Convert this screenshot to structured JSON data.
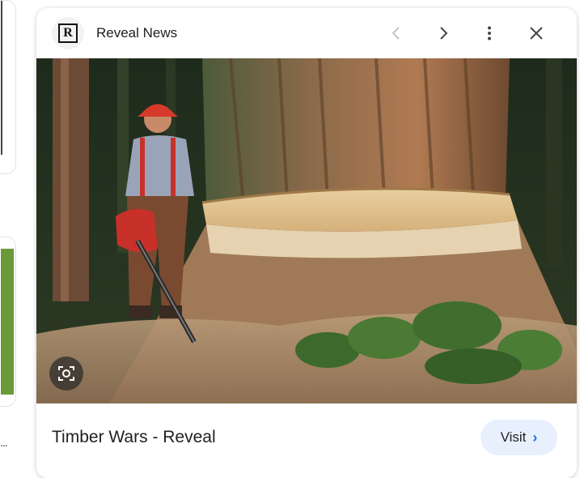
{
  "header": {
    "source_logo_letter": "R",
    "source_name": "Reveal News",
    "icons": [
      "chevron-left-icon",
      "chevron-right-icon",
      "more-vert-icon",
      "close-icon"
    ]
  },
  "image": {
    "alt": "Logger standing next to a giant felled tree with a chainsaw"
  },
  "caption": {
    "title": "Timber Wars - Reveal",
    "visit_label": "Visit",
    "visit_chevron": "›"
  },
  "left_sidebar": {
    "ellipsis": "..."
  },
  "colors": {
    "accent": "#1a73e8",
    "visit_bg": "#e8f0fe",
    "text": "#202124"
  }
}
